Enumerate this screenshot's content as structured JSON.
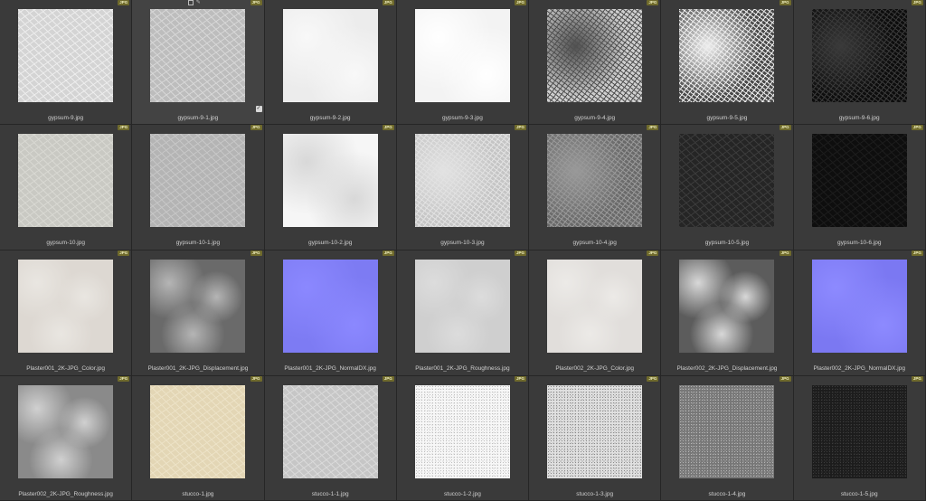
{
  "badge_label": "JPG",
  "hover_tools": [
    "copy-icon",
    "pencil-icon"
  ],
  "checkbox_icon": "check-icon",
  "items": [
    {
      "name": "gypsum-9.jpg",
      "badge": "JPG",
      "tex": {
        "base": "#d4d4d4",
        "var": "#ececec",
        "mode": "fine"
      }
    },
    {
      "name": "gypsum-9-1.jpg",
      "badge": "JPG",
      "tex": {
        "base": "#bdbdbd",
        "var": "#d6d6d6",
        "mode": "fine"
      },
      "selected": true
    },
    {
      "name": "gypsum-9-2.jpg",
      "badge": "JPG",
      "tex": {
        "base": "#ececec",
        "var": "#f8f8f8",
        "mode": "soft"
      }
    },
    {
      "name": "gypsum-9-3.jpg",
      "badge": "JPG",
      "tex": {
        "base": "#f3f3f3",
        "var": "#ffffff",
        "mode": "soft"
      }
    },
    {
      "name": "gypsum-9-4.jpg",
      "badge": "JPG",
      "tex": {
        "base": "#cfcfcf",
        "var": "#505050",
        "mode": "rough"
      }
    },
    {
      "name": "gypsum-9-5.jpg",
      "badge": "JPG",
      "tex": {
        "base": "#4a4a4a",
        "var": "#eeeeee",
        "mode": "rough"
      }
    },
    {
      "name": "gypsum-9-6.jpg",
      "badge": "JPG",
      "tex": {
        "base": "#0d0d0d",
        "var": "#3a3a3a",
        "mode": "rough"
      }
    },
    {
      "name": "gypsum-10.jpg",
      "badge": "JPG",
      "tex": {
        "base": "#c9c9c3",
        "var": "#d8d8d2",
        "mode": "fine"
      }
    },
    {
      "name": "gypsum-10-1.jpg",
      "badge": "JPG",
      "tex": {
        "base": "#b4b4b4",
        "var": "#c6c6c6",
        "mode": "fine"
      }
    },
    {
      "name": "gypsum-10-2.jpg",
      "badge": "JPG",
      "tex": {
        "base": "#f6f6f6",
        "var": "#d8d8d8",
        "mode": "soft"
      }
    },
    {
      "name": "gypsum-10-3.jpg",
      "badge": "JPG",
      "tex": {
        "base": "#c5c5c5",
        "var": "#e2e2e2",
        "mode": "rough"
      }
    },
    {
      "name": "gypsum-10-4.jpg",
      "badge": "JPG",
      "tex": {
        "base": "#6a6a6a",
        "var": "#999999",
        "mode": "rough"
      }
    },
    {
      "name": "gypsum-10-5.jpg",
      "badge": "JPG",
      "tex": {
        "base": "#252525",
        "var": "#3b3b3b",
        "mode": "fine"
      }
    },
    {
      "name": "gypsum-10-6.jpg",
      "badge": "JPG",
      "tex": {
        "base": "#0e0e0e",
        "var": "#1c1c1c",
        "mode": "fine"
      }
    },
    {
      "name": "Plaster001_2K-JPG_Color.jpg",
      "badge": "JPG",
      "tex": {
        "base": "#ddd8d2",
        "var": "#e9e6e1",
        "mode": "cloud"
      }
    },
    {
      "name": "Plaster001_2K-JPG_Displacement.jpg",
      "badge": "JPG",
      "tex": {
        "base": "#6a6a6a",
        "var": "#b5b5b5",
        "mode": "cloud"
      }
    },
    {
      "name": "Plaster001_2K-JPG_NormalDX.jpg",
      "badge": "JPG",
      "tex": {
        "base": "#7d7bf3",
        "var": "#8b88ff",
        "mode": "soft"
      }
    },
    {
      "name": "Plaster001_2K-JPG_Roughness.jpg",
      "badge": "JPG",
      "tex": {
        "base": "#cfcfcf",
        "var": "#dcdcdc",
        "mode": "cloud"
      }
    },
    {
      "name": "Plaster002_2K-JPG_Color.jpg",
      "badge": "JPG",
      "tex": {
        "base": "#e1dedb",
        "var": "#eceae7",
        "mode": "cloud"
      }
    },
    {
      "name": "Plaster002_2K-JPG_Displacement.jpg",
      "badge": "JPG",
      "tex": {
        "base": "#5c5c5c",
        "var": "#d8d8d8",
        "mode": "cloud"
      }
    },
    {
      "name": "Plaster002_2K-JPG_NormalDX.jpg",
      "badge": "JPG",
      "tex": {
        "base": "#7b78f2",
        "var": "#8d8aff",
        "mode": "soft"
      }
    },
    {
      "name": "Plaster002_2K-JPG_Roughness.jpg",
      "badge": "JPG",
      "tex": {
        "base": "#8a8a8a",
        "var": "#d0d0d0",
        "mode": "cloud"
      }
    },
    {
      "name": "stucco-1.jpg",
      "badge": "JPG",
      "tex": {
        "base": "#e3d6b5",
        "var": "#ece2c6",
        "mode": "fine"
      }
    },
    {
      "name": "stucco-1-1.jpg",
      "badge": "JPG",
      "tex": {
        "base": "#c6c6c6",
        "var": "#d9d9d9",
        "mode": "fine"
      }
    },
    {
      "name": "stucco-1-2.jpg",
      "badge": "JPG",
      "tex": {
        "base": "#f7f7f7",
        "var": "#bfbfbf",
        "mode": "speck"
      }
    },
    {
      "name": "stucco-1-3.jpg",
      "badge": "JPG",
      "tex": {
        "base": "#e0e0e0",
        "var": "#8a8a8a",
        "mode": "speck"
      }
    },
    {
      "name": "stucco-1-4.jpg",
      "badge": "JPG",
      "tex": {
        "base": "#777777",
        "var": "#b5b5b5",
        "mode": "speck"
      }
    },
    {
      "name": "stucco-1-5.jpg",
      "badge": "JPG",
      "tex": {
        "base": "#1c1c1c",
        "var": "#3c3c3c",
        "mode": "speck"
      }
    }
  ]
}
